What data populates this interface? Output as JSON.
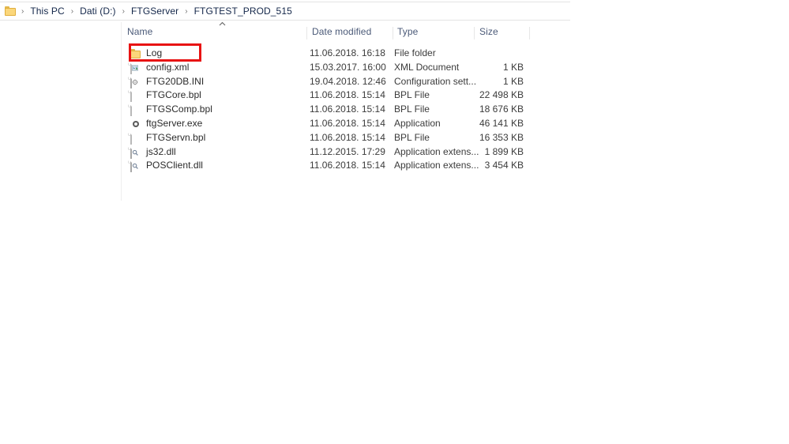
{
  "window": {
    "address_bar": {
      "folder_icon": "folder-icon",
      "separator": "›",
      "crumbs": [
        "This PC",
        "Dati (D:)",
        "FTGServer",
        "FTGTEST_PROD_515"
      ]
    }
  },
  "file_list": {
    "columns": [
      {
        "label": "Name",
        "sorted": true,
        "sort_direction": "ascending",
        "sort_caret": "caret-up-icon"
      },
      {
        "label": "Date modified",
        "sorted": false
      },
      {
        "label": "Type",
        "sorted": false
      },
      {
        "label": "Size",
        "sorted": false
      }
    ],
    "rows": [
      {
        "icon": "folder-icon",
        "name": "Log",
        "date_modified": "11.06.2018. 16:18",
        "type": "File folder",
        "size": ""
      },
      {
        "icon": "xml-file-icon",
        "name": "config.xml",
        "date_modified": "15.03.2017. 16:00",
        "type": "XML Document",
        "size": "1 KB"
      },
      {
        "icon": "ini-file-icon",
        "name": "FTG20DB.INI",
        "date_modified": "19.04.2018. 12:46",
        "type": "Configuration sett...",
        "size": "1 KB"
      },
      {
        "icon": "blank-file-icon",
        "name": "FTGCore.bpl",
        "date_modified": "11.06.2018. 15:14",
        "type": "BPL File",
        "size": "22 498 KB"
      },
      {
        "icon": "blank-file-icon",
        "name": "FTGSComp.bpl",
        "date_modified": "11.06.2018. 15:14",
        "type": "BPL File",
        "size": "18 676 KB"
      },
      {
        "icon": "application-icon",
        "name": "ftgServer.exe",
        "date_modified": "11.06.2018. 15:14",
        "type": "Application",
        "size": "46 141 KB"
      },
      {
        "icon": "blank-file-icon",
        "name": "FTGServn.bpl",
        "date_modified": "11.06.2018. 15:14",
        "type": "BPL File",
        "size": "16 353 KB"
      },
      {
        "icon": "dll-file-icon",
        "name": "js32.dll",
        "date_modified": "11.12.2015. 17:29",
        "type": "Application extens...",
        "size": "1 899 KB"
      },
      {
        "icon": "dll-file-icon",
        "name": "POSClient.dll",
        "date_modified": "11.06.2018. 15:14",
        "type": "Application extens...",
        "size": "3 454 KB"
      }
    ]
  },
  "annotation": {
    "highlight_target": "Log",
    "color": "#e81313"
  }
}
